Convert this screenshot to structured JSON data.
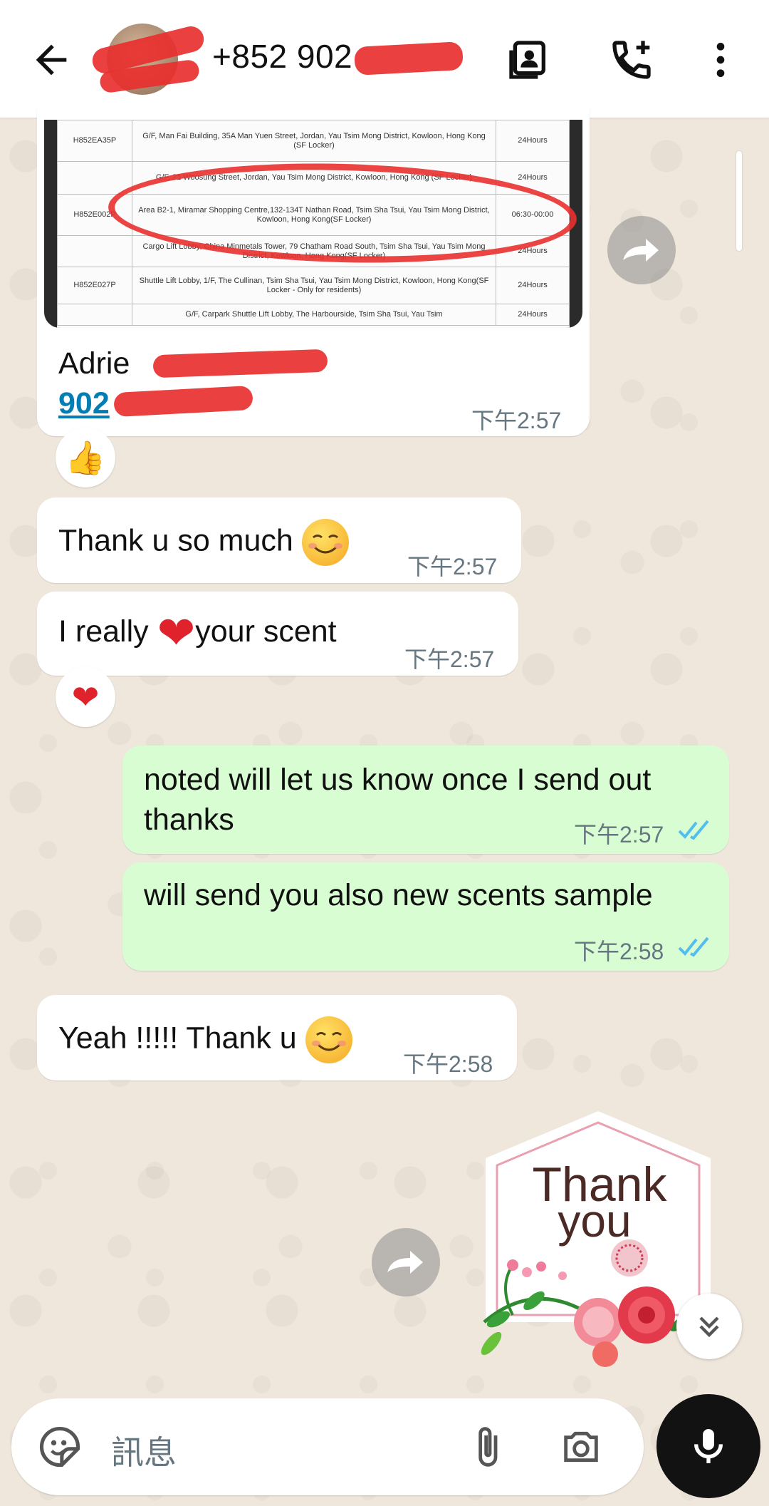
{
  "header": {
    "contact_phone": "+852 902",
    "icons": [
      "back-arrow-icon",
      "contact-card-icon",
      "add-call-icon",
      "more-vert-icon"
    ]
  },
  "image_message": {
    "table_rows": [
      {
        "code": "H852EA35P",
        "address": "G/F, Man Fai Building, 35A Man Yuen Street, Jordan, Yau Tsim Mong District, Kowloon, Hong Kong (SF Locker)",
        "hours": "24Hours"
      },
      {
        "code": "",
        "address": "G/F, 21 Woosung Street, Jordan, Yau Tsim Mong District, Kowloon, Hong Kong (SF Locker)",
        "hours": "24Hours"
      },
      {
        "code": "H852E002P",
        "address": "Area B2-1, Miramar Shopping Centre,132-134T Nathan Road, Tsim Sha Tsui, Yau Tsim Mong District, Kowloon, Hong Kong(SF Locker)",
        "hours": "06:30-00:00"
      },
      {
        "code": "",
        "address": "Cargo Lift Lobby, China Minmetals Tower, 79 Chatham Road South, Tsim Sha Tsui, Yau Tsim Mong District, Kowloon, Hong Kong(SF Locker)",
        "hours": "24Hours"
      },
      {
        "code": "H852E027P",
        "address": "Shuttle Lift Lobby, 1/F, The Cullinan, Tsim Sha Tsui, Yau Tsim Mong District, Kowloon, Hong Kong(SF Locker - Only for residents)",
        "hours": "24Hours"
      },
      {
        "code": "",
        "address": "G/F, Carpark Shuttle Lift Lobby, The Harbourside, Tsim Sha Tsui, Yau Tsim",
        "hours": "24Hours"
      }
    ],
    "caption_name": "Adrie",
    "caption_phone": "902",
    "time": "下午2:57",
    "reaction": "👍"
  },
  "messages": [
    {
      "dir": "in",
      "text": "Thank u so much",
      "emoji": "smile",
      "time": "下午2:57"
    },
    {
      "dir": "in",
      "text_before": "I really",
      "text_after": "your scent",
      "emoji": "heart",
      "time": "下午2:57",
      "reaction": "❤"
    },
    {
      "dir": "out",
      "text": "noted will let us know once I send out thanks",
      "time": "下午2:57"
    },
    {
      "dir": "out",
      "text": "will send you also new scents sample",
      "time": "下午2:58"
    },
    {
      "dir": "in",
      "text": "Yeah !!!!! Thank u",
      "emoji": "smile",
      "time": "下午2:58"
    }
  ],
  "sticker": {
    "text_line1": "Thank",
    "text_line2": "you"
  },
  "composer": {
    "placeholder": "訊息"
  },
  "colors": {
    "incoming": "#ffffff",
    "outgoing": "#d9fdd3",
    "tick_read": "#53bdeb",
    "redaction": "#e8302f"
  }
}
